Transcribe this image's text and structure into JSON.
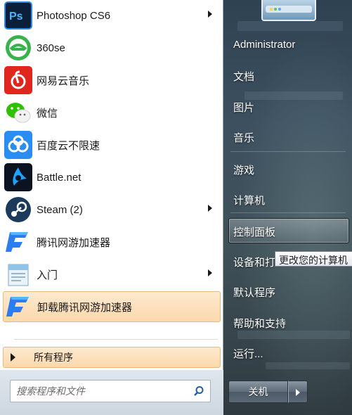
{
  "start_menu": {
    "pinned_programs": [
      {
        "label": "Photoshop CS6",
        "icon": "photoshop-icon",
        "has_submenu": true
      },
      {
        "label": "360se",
        "icon": "360se-icon",
        "has_submenu": false
      },
      {
        "label": "网易云音乐",
        "icon": "netease-music-icon",
        "has_submenu": false
      },
      {
        "label": "微信",
        "icon": "wechat-icon",
        "has_submenu": false
      },
      {
        "label": "百度云不限速",
        "icon": "baidu-cloud-icon",
        "has_submenu": false
      },
      {
        "label": "Battle.net",
        "icon": "battlenet-icon",
        "has_submenu": false
      },
      {
        "label": "Steam (2)",
        "icon": "steam-icon",
        "has_submenu": true
      },
      {
        "label": "腾讯网游加速器",
        "icon": "tencent-accelerator-icon",
        "has_submenu": false
      },
      {
        "label": "入门",
        "icon": "getting-started-icon",
        "has_submenu": true
      },
      {
        "label": "卸载腾讯网游加速器",
        "icon": "tencent-accelerator-icon",
        "has_submenu": false,
        "highlighted": true
      }
    ],
    "all_programs_label": "所有程序",
    "search_placeholder": "搜索程序和文件",
    "right_items": [
      {
        "label": "Administrator"
      },
      {
        "label": "文档"
      },
      {
        "label": "图片"
      },
      {
        "label": "音乐"
      },
      {
        "label": "游戏"
      },
      {
        "label": "计算机"
      },
      {
        "label": "控制面板",
        "hovered": true
      },
      {
        "label": "设备和打"
      },
      {
        "label": "默认程序"
      },
      {
        "label": "帮助和支持"
      },
      {
        "label": "运行..."
      }
    ],
    "tooltip": "更改您的计算机",
    "shutdown_label": "关机",
    "colors": {
      "highlight_bg": "#fbd9ad",
      "highlight_border": "#e6b980",
      "right_pane_bg": "#3d5060"
    }
  }
}
